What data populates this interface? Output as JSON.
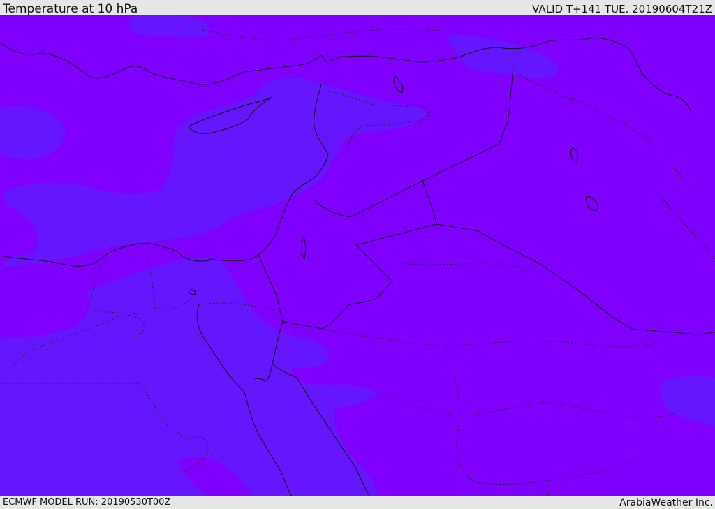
{
  "header": {
    "title": "Temperature at 10 hPa",
    "valid": "VALID T+141 TUE. 20190604T21Z"
  },
  "footer": {
    "model_run": "ECMWF MODEL RUN: 20190530T00Z",
    "credit": "ArabiaWeather Inc."
  },
  "map": {
    "colors": {
      "warm_field": "#7f00ff",
      "cool_field": "#6516ff",
      "border": "#111111"
    }
  }
}
